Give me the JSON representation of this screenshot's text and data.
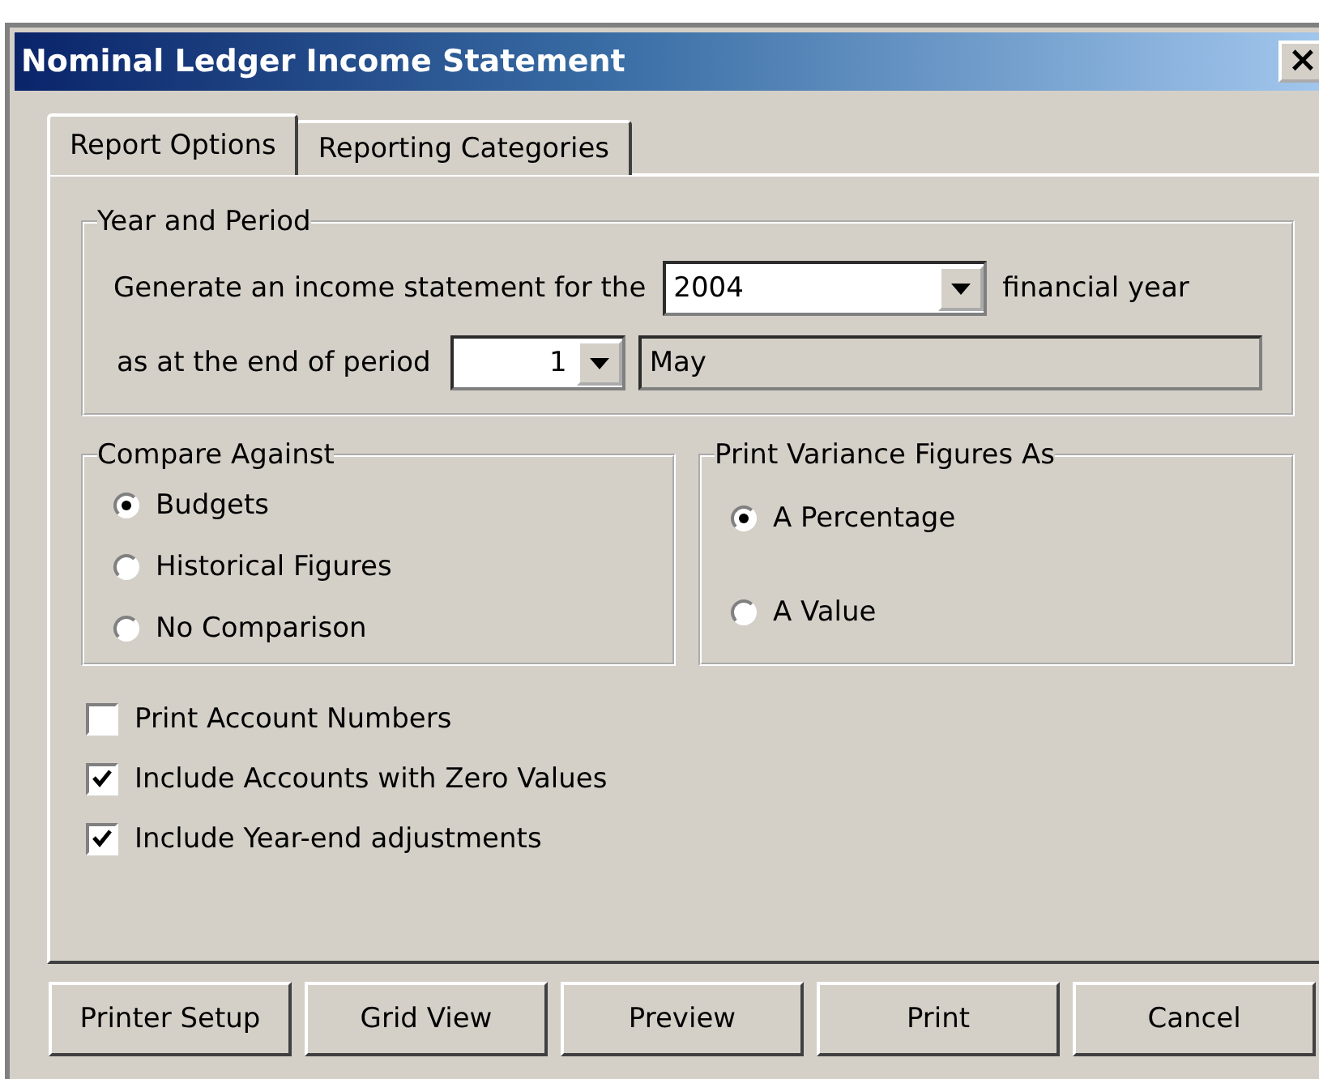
{
  "window": {
    "title": "Nominal Ledger Income Statement",
    "close": "×"
  },
  "tabs": [
    {
      "label": "Report Options",
      "selected": true
    },
    {
      "label": "Reporting Categories",
      "selected": false
    }
  ],
  "year_and_period": {
    "title": "Year and Period",
    "line1_label": "Generate an income statement for the",
    "year": "2004",
    "line1_suffix": "financial year",
    "line2_label": "as at the end of period",
    "period": "1",
    "period_name": "May"
  },
  "compare_against": {
    "title": "Compare Against",
    "options": [
      {
        "label": "Budgets",
        "selected": true
      },
      {
        "label": "Historical Figures",
        "selected": false
      },
      {
        "label": "No Comparison",
        "selected": false
      }
    ]
  },
  "print_variance": {
    "title": "Print Variance Figures As",
    "options": [
      {
        "label": "A Percentage",
        "selected": true
      },
      {
        "label": "A Value",
        "selected": false
      }
    ]
  },
  "checkboxes": [
    {
      "label": "Print Account Numbers",
      "checked": false
    },
    {
      "label": "Include Accounts with Zero Values",
      "checked": true
    },
    {
      "label": "Include Year-end adjustments",
      "checked": true
    }
  ],
  "buttons": [
    "Printer Setup",
    "Grid View",
    "Preview",
    "Print",
    "Cancel"
  ]
}
